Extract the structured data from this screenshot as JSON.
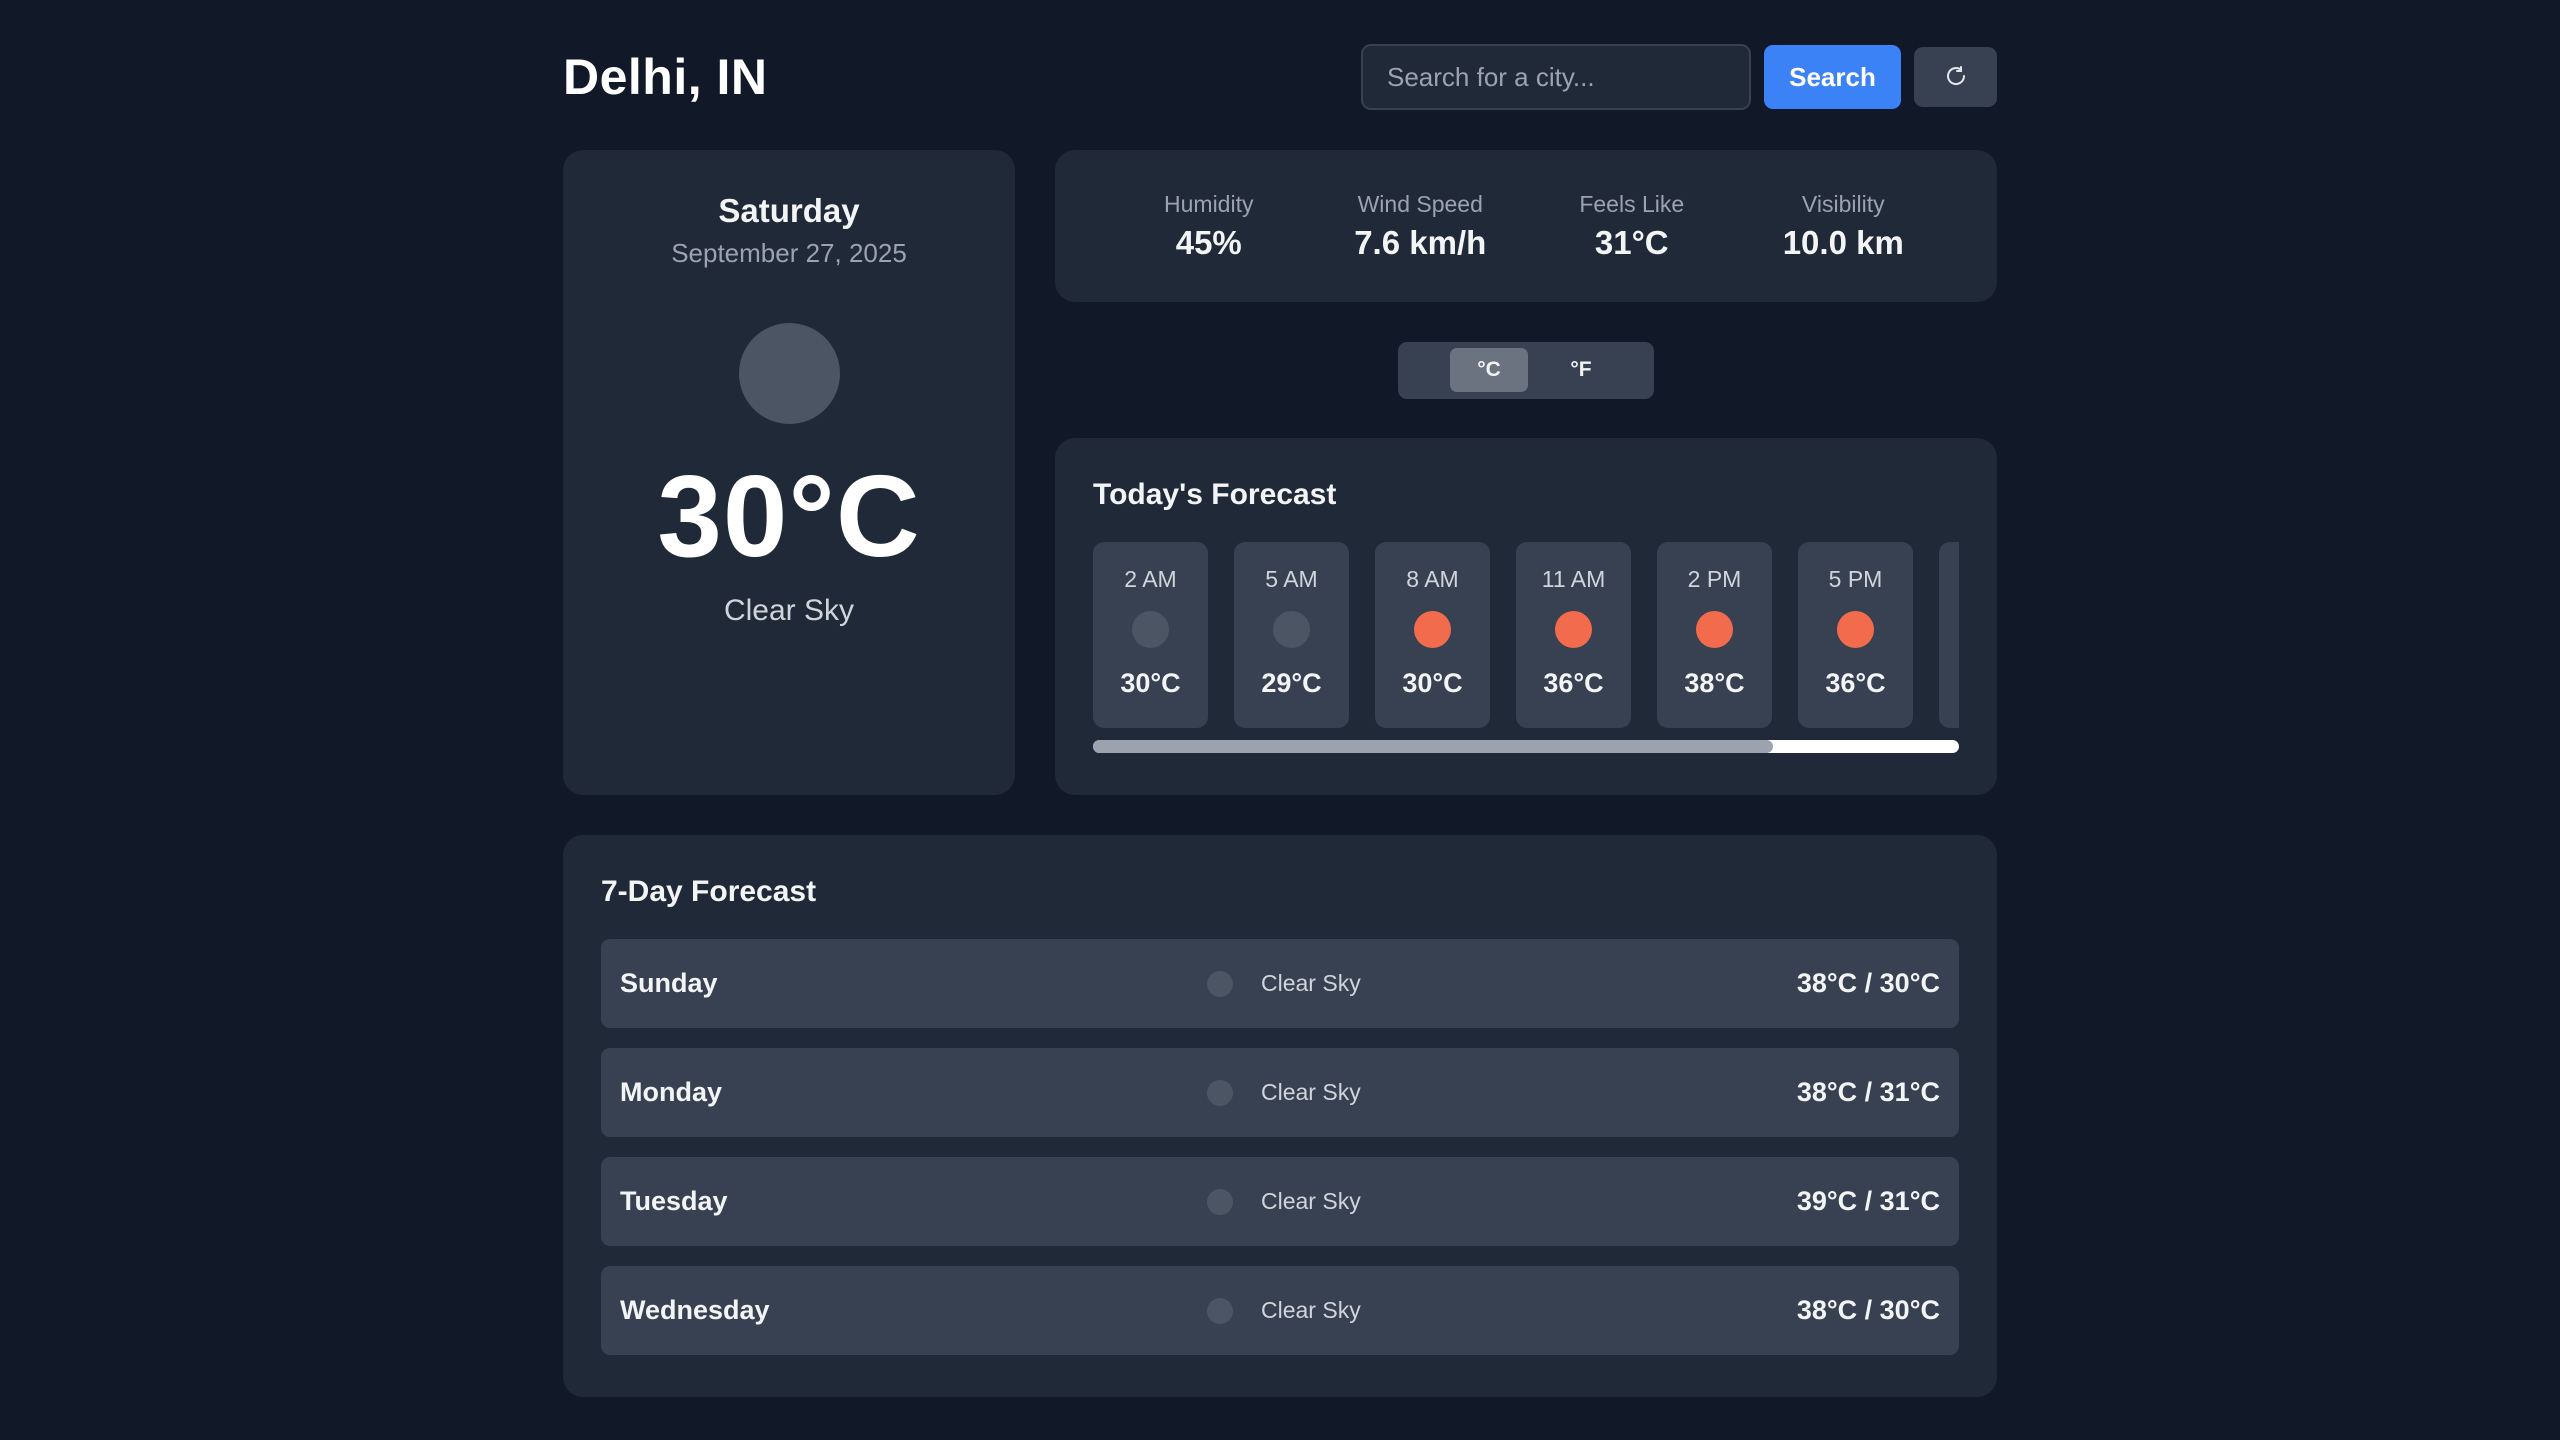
{
  "header": {
    "city": "Delhi, IN",
    "search_placeholder": "Search for a city...",
    "search_label": "Search",
    "refresh_icon": "refresh-icon"
  },
  "current": {
    "day": "Saturday",
    "date": "September 27, 2025",
    "temperature": "30°C",
    "condition": "Clear Sky",
    "icon": "night-moon-icon",
    "icon_color": "#4b5563"
  },
  "stats": [
    {
      "label": "Humidity",
      "value": "45%"
    },
    {
      "label": "Wind Speed",
      "value": "7.6 km/h"
    },
    {
      "label": "Feels Like",
      "value": "31°C"
    },
    {
      "label": "Visibility",
      "value": "10.0 km"
    }
  ],
  "units": {
    "celsius": "°C",
    "fahrenheit": "°F",
    "active": "celsius"
  },
  "hourly": {
    "title": "Today's Forecast",
    "scroll_position": 0.785,
    "items": [
      {
        "time": "2 AM",
        "temp": "30°C",
        "icon": "night-icon",
        "color": "#4b5563"
      },
      {
        "time": "5 AM",
        "temp": "29°C",
        "icon": "night-icon",
        "color": "#4b5563"
      },
      {
        "time": "8 AM",
        "temp": "30°C",
        "icon": "sun-icon",
        "color": "#f26b4c"
      },
      {
        "time": "11 AM",
        "temp": "36°C",
        "icon": "sun-icon",
        "color": "#f26b4c"
      },
      {
        "time": "2 PM",
        "temp": "38°C",
        "icon": "sun-icon",
        "color": "#f26b4c"
      },
      {
        "time": "5 PM",
        "temp": "36°C",
        "icon": "sun-icon",
        "color": "#f26b4c"
      },
      {
        "time": "",
        "temp": "",
        "icon": "",
        "color": "#374151"
      }
    ]
  },
  "weekly": {
    "title": "7-Day Forecast",
    "days": [
      {
        "day": "Sunday",
        "condition": "Clear Sky",
        "temps": "38°C / 30°C"
      },
      {
        "day": "Monday",
        "condition": "Clear Sky",
        "temps": "38°C / 31°C"
      },
      {
        "day": "Tuesday",
        "condition": "Clear Sky",
        "temps": "39°C / 31°C"
      },
      {
        "day": "Wednesday",
        "condition": "Clear Sky",
        "temps": "38°C / 30°C"
      }
    ]
  },
  "colors": {
    "background": "#111827",
    "card": "#1f2937",
    "accent": "#3b82f6",
    "sun": "#f26b4c"
  }
}
